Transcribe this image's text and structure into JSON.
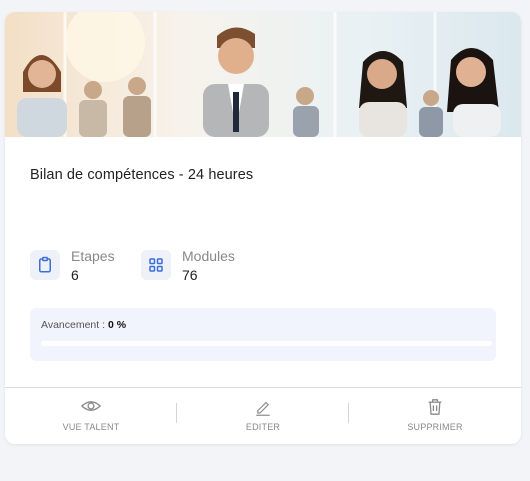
{
  "card": {
    "title": "Bilan de compétences - 24 heures",
    "banner_alt": "team-photo",
    "stats": [
      {
        "label": "Etapes",
        "value": "6",
        "icon": "clipboard-icon"
      },
      {
        "label": "Modules",
        "value": "76",
        "icon": "grid-icon"
      }
    ],
    "progress": {
      "label": "Avancement :",
      "value_text": "0 %",
      "fraction": 0
    },
    "actions": [
      {
        "label": "VUE TALENT",
        "icon": "eye-icon"
      },
      {
        "label": "EDITER",
        "icon": "pencil-icon"
      },
      {
        "label": "SUPPRIMER",
        "icon": "trash-icon"
      }
    ]
  },
  "colors": {
    "accent": "#3b6fd6",
    "icon_bg": "#eef1f8",
    "progress_bg": "#f1f4fc",
    "page_bg": "#f3f4f7"
  }
}
